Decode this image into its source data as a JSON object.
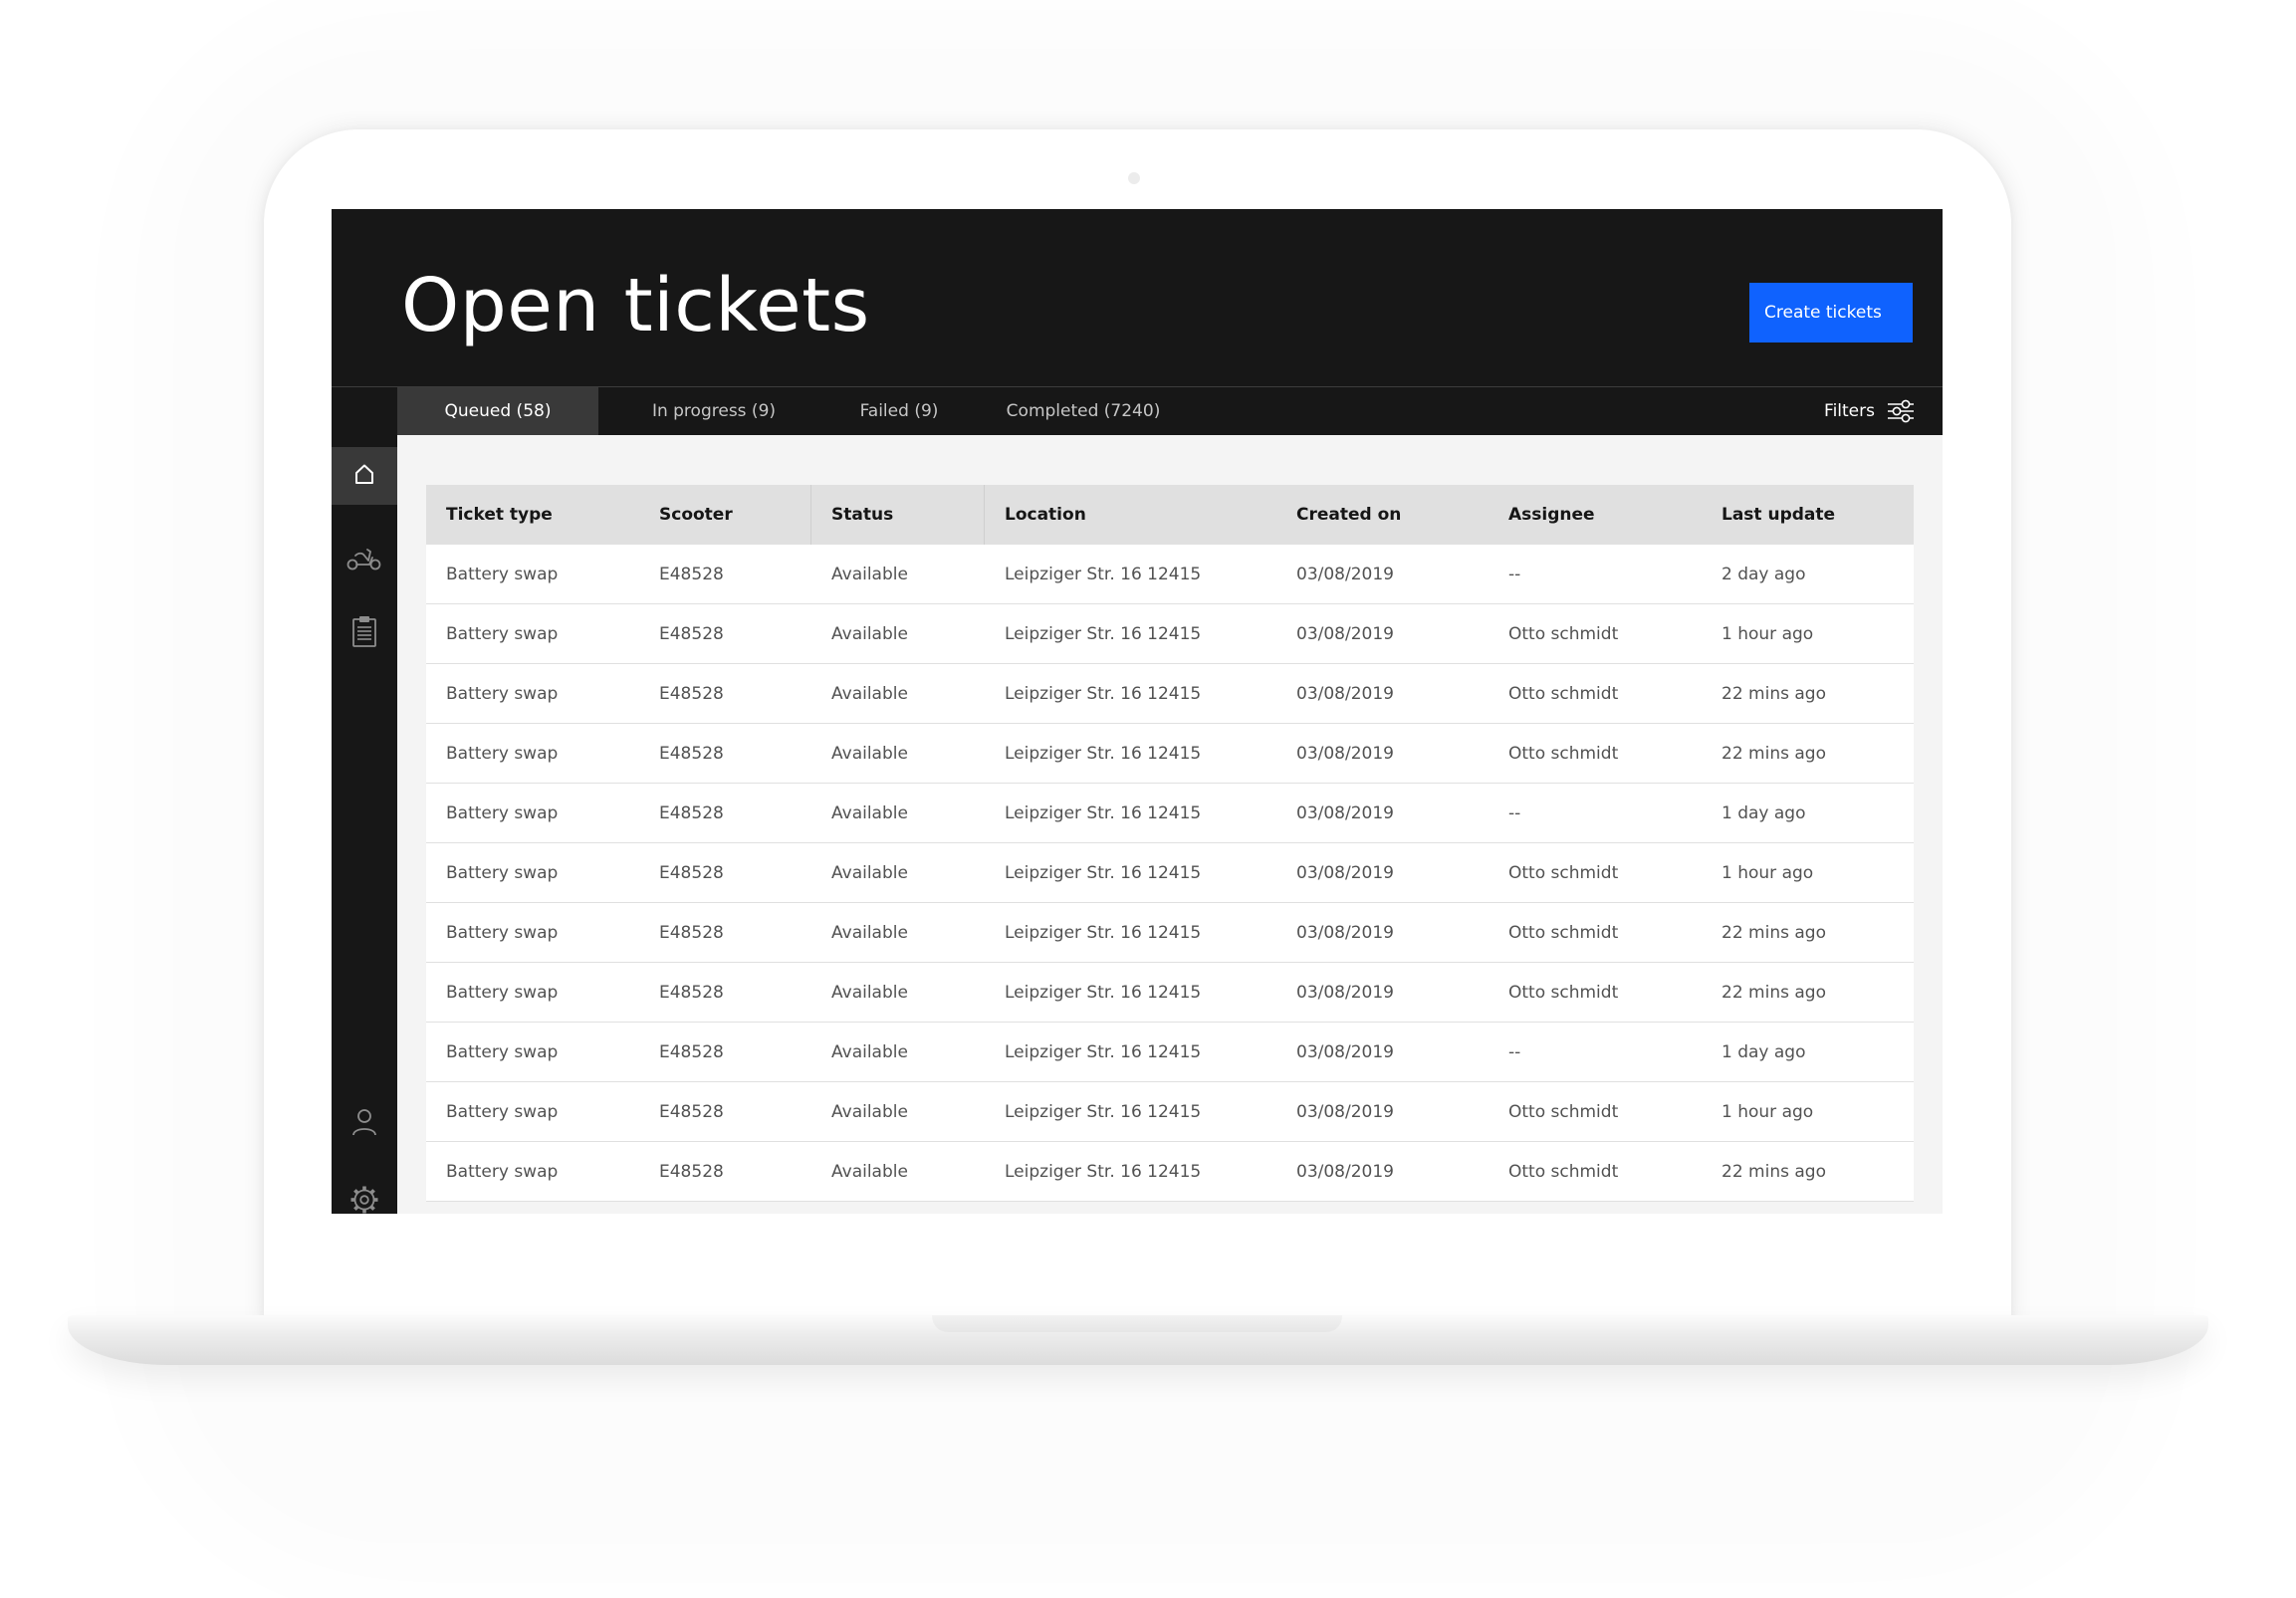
{
  "header": {
    "title": "Open tickets",
    "create_button": "Create tickets"
  },
  "tabs": [
    {
      "label": "Queued (58)",
      "active": true
    },
    {
      "label": "In progress (9)",
      "active": false
    },
    {
      "label": "Failed (9)",
      "active": false
    },
    {
      "label": "Completed (7240)",
      "active": false
    }
  ],
  "filters": {
    "label": "Filters",
    "icon": "sliders-icon"
  },
  "sidebar": {
    "items": [
      {
        "icon": "home-icon",
        "active": true
      },
      {
        "icon": "scooter-icon",
        "active": false
      },
      {
        "icon": "clipboard-icon",
        "active": false
      },
      {
        "icon": "user-icon",
        "active": false
      },
      {
        "icon": "settings-icon",
        "active": false
      }
    ]
  },
  "table": {
    "columns": [
      "Ticket type",
      "Scooter",
      "Status",
      "Location",
      "Created on",
      "Assignee",
      "Last update"
    ],
    "rows": [
      [
        "Battery swap",
        "E48528",
        "Available",
        "Leipziger Str. 16 12415",
        "03/08/2019",
        "--",
        "2 day ago"
      ],
      [
        "Battery swap",
        "E48528",
        "Available",
        "Leipziger Str. 16 12415",
        "03/08/2019",
        "Otto schmidt",
        "1 hour ago"
      ],
      [
        "Battery swap",
        "E48528",
        "Available",
        "Leipziger Str. 16 12415",
        "03/08/2019",
        "Otto schmidt",
        "22 mins ago"
      ],
      [
        "Battery swap",
        "E48528",
        "Available",
        "Leipziger Str. 16 12415",
        "03/08/2019",
        "Otto schmidt",
        "22 mins ago"
      ],
      [
        "Battery swap",
        "E48528",
        "Available",
        "Leipziger Str. 16 12415",
        "03/08/2019",
        "--",
        "1 day ago"
      ],
      [
        "Battery swap",
        "E48528",
        "Available",
        "Leipziger Str. 16 12415",
        "03/08/2019",
        "Otto schmidt",
        "1 hour ago"
      ],
      [
        "Battery swap",
        "E48528",
        "Available",
        "Leipziger Str. 16 12415",
        "03/08/2019",
        "Otto schmidt",
        "22 mins ago"
      ],
      [
        "Battery swap",
        "E48528",
        "Available",
        "Leipziger Str. 16 12415",
        "03/08/2019",
        "Otto schmidt",
        "22 mins ago"
      ],
      [
        "Battery swap",
        "E48528",
        "Available",
        "Leipziger Str. 16 12415",
        "03/08/2019",
        "--",
        "1 day ago"
      ],
      [
        "Battery swap",
        "E48528",
        "Available",
        "Leipziger Str. 16 12415",
        "03/08/2019",
        "Otto schmidt",
        "1 hour ago"
      ],
      [
        "Battery swap",
        "E48528",
        "Available",
        "Leipziger Str. 16 12415",
        "03/08/2019",
        "Otto schmidt",
        "22 mins ago"
      ]
    ]
  },
  "colors": {
    "accent": "#0f62fe",
    "header_bg": "#171717",
    "active_tab_bg": "#393939",
    "table_header_bg": "#e0e0e0",
    "content_bg": "#f4f4f4"
  }
}
